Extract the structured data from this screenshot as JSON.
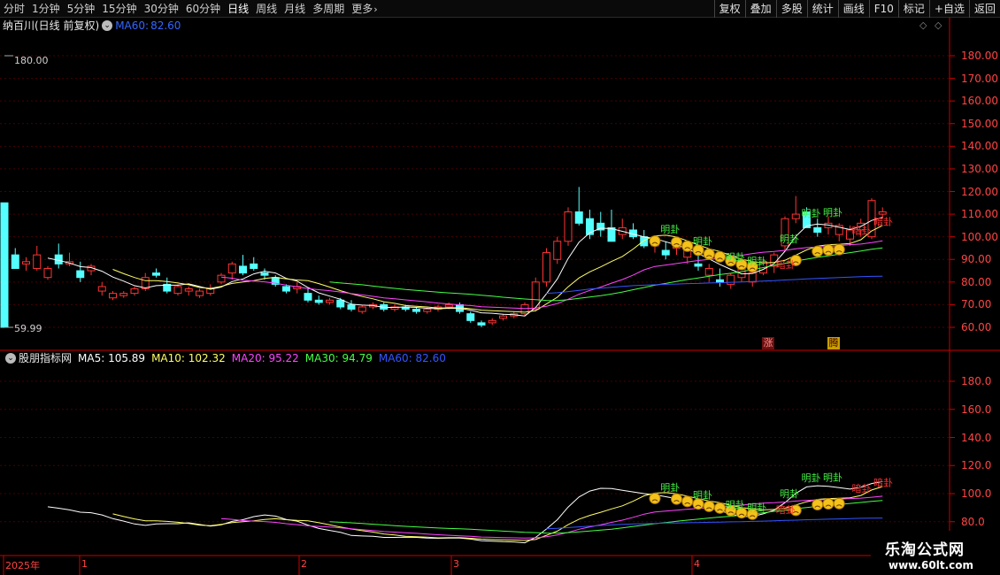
{
  "toolbar": {
    "periods": [
      "分时",
      "1分钟",
      "5分钟",
      "15分钟",
      "30分钟",
      "60分钟",
      "日线",
      "周线",
      "月线",
      "多周期",
      "更多"
    ],
    "active_period": "日线",
    "buttons": [
      "复权",
      "叠加",
      "多股",
      "统计",
      "画线",
      "F10",
      "标记",
      "+自选",
      "返回"
    ]
  },
  "header": {
    "stock_name": "纳百川(日线 前复权)",
    "ma60_label": "MA60:",
    "ma60_value": "82.60"
  },
  "indicator": {
    "name": "股朋指标网",
    "items": [
      {
        "label": "MA5:",
        "value": "105.89",
        "color": "#ffffff"
      },
      {
        "label": "MA10:",
        "value": "102.32",
        "color": "#ffff66"
      },
      {
        "label": "MA20:",
        "value": "95.22",
        "color": "#ff44ff"
      },
      {
        "label": "MA30:",
        "value": "94.79",
        "color": "#44ff44"
      },
      {
        "label": "MA60:",
        "value": "82.60",
        "color": "#3355ff"
      }
    ]
  },
  "price_axis": [
    "180.00",
    "170.00",
    "160.00",
    "150.00",
    "140.00",
    "130.00",
    "120.00",
    "110.00",
    "100.00",
    "90.00",
    "80.00",
    "70.00",
    "60.00"
  ],
  "indicator_axis": [
    "180.0",
    "160.0",
    "140.0",
    "120.0",
    "100.0",
    "80.0"
  ],
  "extremes": {
    "high": "180.00",
    "low": "59.99"
  },
  "date_axis": [
    {
      "label": "2025年"
    },
    {
      "label": "1"
    },
    {
      "label": "2"
    },
    {
      "label": "3"
    },
    {
      "label": "4"
    }
  ],
  "signal_tags": {
    "zhang": "涨",
    "teng": "腾"
  },
  "signal_text": {
    "ming": "明卦",
    "an": "暗卦"
  },
  "watermark": {
    "title": "乐淘公式网",
    "url": "www.60lt.com"
  },
  "colors": {
    "up": "#ff3333",
    "down": "#54ffff",
    "ma5": "#ffffff",
    "ma10": "#ffff66",
    "ma20": "#ff44ff",
    "ma30": "#44ff44",
    "ma60": "#3355ff",
    "axis": "#cc0000"
  },
  "chart_data": {
    "type": "candlestick",
    "ylim": [
      55,
      185
    ],
    "candles": [
      [
        115,
        115,
        60,
        60
      ],
      [
        92,
        95,
        86,
        86
      ],
      [
        88,
        91,
        85,
        89
      ],
      [
        86,
        96,
        85,
        92
      ],
      [
        82,
        87,
        81,
        86
      ],
      [
        92,
        97,
        86,
        88
      ],
      [
        88,
        93,
        87,
        89
      ],
      [
        85,
        89,
        80,
        82
      ],
      [
        85,
        88,
        83,
        87
      ],
      [
        76,
        80,
        74,
        78
      ],
      [
        73,
        76,
        72,
        75
      ],
      [
        74,
        76,
        73,
        75
      ],
      [
        75,
        78,
        74,
        77
      ],
      [
        77,
        84,
        76,
        82
      ],
      [
        84,
        86,
        82,
        83
      ],
      [
        79,
        82,
        75,
        76
      ],
      [
        75,
        79,
        74,
        78
      ],
      [
        76,
        78,
        74,
        77
      ],
      [
        74,
        77,
        73,
        76
      ],
      [
        75,
        79,
        74,
        77
      ],
      [
        80,
        84,
        79,
        83
      ],
      [
        84,
        89,
        81,
        88
      ],
      [
        87,
        92,
        83,
        84
      ],
      [
        88,
        91,
        85,
        86
      ],
      [
        84,
        86,
        81,
        83
      ],
      [
        82,
        83,
        78,
        79
      ],
      [
        78,
        79,
        75,
        76
      ],
      [
        77,
        80,
        75,
        78
      ],
      [
        75,
        77,
        71,
        72
      ],
      [
        72,
        74,
        70,
        71
      ],
      [
        71,
        73,
        70,
        72
      ],
      [
        72,
        73,
        68,
        69
      ],
      [
        70,
        72,
        67,
        68
      ],
      [
        67,
        70,
        66,
        69
      ],
      [
        69,
        71,
        68,
        70
      ],
      [
        70,
        71,
        67,
        68
      ],
      [
        68,
        70,
        67,
        69
      ],
      [
        69,
        70,
        67,
        68
      ],
      [
        68,
        69,
        66,
        67
      ],
      [
        67,
        69,
        66,
        68
      ],
      [
        68,
        70,
        67,
        69
      ],
      [
        69,
        71,
        68,
        70
      ],
      [
        70,
        71,
        66,
        67
      ],
      [
        66,
        67,
        62,
        63
      ],
      [
        62,
        63,
        60,
        61
      ],
      [
        62,
        64,
        61,
        63
      ],
      [
        64,
        66,
        63,
        65
      ],
      [
        65,
        67,
        64,
        66
      ],
      [
        66,
        71,
        65,
        70
      ],
      [
        68,
        82,
        67,
        80
      ],
      [
        80,
        95,
        78,
        93
      ],
      [
        90,
        100,
        88,
        98
      ],
      [
        98,
        113,
        96,
        111
      ],
      [
        111,
        122,
        105,
        106
      ],
      [
        108,
        112,
        99,
        101
      ],
      [
        106,
        111,
        100,
        103
      ],
      [
        104,
        112,
        98,
        98
      ],
      [
        101,
        108,
        99,
        104
      ],
      [
        103,
        106,
        99,
        100
      ],
      [
        100,
        103,
        95,
        96
      ],
      [
        96,
        100,
        93,
        98
      ],
      [
        94,
        98,
        90,
        92
      ],
      [
        95,
        99,
        92,
        96
      ],
      [
        91,
        96,
        88,
        94
      ],
      [
        88,
        92,
        85,
        87
      ],
      [
        83,
        88,
        80,
        86
      ],
      [
        81,
        86,
        78,
        80
      ],
      [
        79,
        84,
        77,
        83
      ],
      [
        82,
        87,
        80,
        86
      ],
      [
        80,
        85,
        78,
        84
      ],
      [
        84,
        90,
        83,
        89
      ],
      [
        87,
        93,
        84,
        92
      ],
      [
        96,
        109,
        94,
        108
      ],
      [
        108,
        118,
        106,
        110
      ],
      [
        111,
        113,
        104,
        104
      ],
      [
        104,
        108,
        100,
        102
      ],
      [
        104,
        109,
        101,
        106
      ],
      [
        101,
        106,
        98,
        105
      ],
      [
        99,
        105,
        96,
        103
      ],
      [
        103,
        108,
        100,
        106
      ],
      [
        100,
        117,
        99,
        116
      ],
      [
        110,
        113,
        108,
        111
      ]
    ],
    "ma5": [
      null,
      null,
      null,
      null,
      90.6,
      89.6,
      88.4,
      86.8,
      86.4,
      84.8,
      82.2,
      80.4,
      78.4,
      77.4,
      78.4,
      78.6,
      78.6,
      79.2,
      78.0,
      76.8,
      77.8,
      80.2,
      81.4,
      83.6,
      84.8,
      84.0,
      81.6,
      80.4,
      77.6,
      75.2,
      73.8,
      72.4,
      70.2,
      69.8,
      69.6,
      68.8,
      68.8,
      69.0,
      68.8,
      68.4,
      68.2,
      68.4,
      68.4,
      67.6,
      66.4,
      66.2,
      65.8,
      65.6,
      65.0,
      68.8,
      74.8,
      81.4,
      90.4,
      97.6,
      101.8,
      103.8,
      103.6,
      102.4,
      101.2,
      100.0,
      99.2,
      97.8,
      96.4,
      94.6,
      92.6,
      90.2,
      87.8,
      85.6,
      83.6,
      83.8,
      85.6,
      88.2,
      93.6,
      100.2,
      104.8,
      105.6,
      105.2,
      104.2,
      103.2,
      104.6,
      107.2,
      108.6
    ],
    "ma10": [
      null,
      null,
      null,
      null,
      null,
      null,
      null,
      null,
      null,
      null,
      85.6,
      83.7,
      82.0,
      80.6,
      80.6,
      80.2,
      79.6,
      78.8,
      77.6,
      77.2,
      78.1,
      79.4,
      80.0,
      80.6,
      81.6,
      82.1,
      81.4,
      80.9,
      80.6,
      79.3,
      77.8,
      76.2,
      74.8,
      73.6,
      72.6,
      71.3,
      70.6,
      69.6,
      69.3,
      69.0,
      68.5,
      68.6,
      68.7,
      68.2,
      67.6,
      67.3,
      67.1,
      66.9,
      66.7,
      67.3,
      70.3,
      73.3,
      77.9,
      81.8,
      84.5,
      86.7,
      89.1,
      91.3,
      94.6,
      98.4,
      100.4,
      100.7,
      99.9,
      98.2,
      96.4,
      94.7,
      93.5,
      91.7,
      90.1,
      89.1,
      88.4,
      88.7,
      89.6,
      91.9,
      94.2,
      95.9,
      96.5,
      96.7,
      97.0,
      98.7,
      102.6,
      105.0
    ],
    "ma20": [
      null,
      null,
      null,
      null,
      null,
      null,
      null,
      null,
      null,
      null,
      null,
      null,
      null,
      null,
      null,
      null,
      null,
      null,
      null,
      null,
      82.2,
      81.7,
      80.8,
      80.4,
      80.1,
      79.5,
      78.6,
      77.9,
      77.1,
      76.6,
      76.2,
      75.6,
      74.9,
      74.3,
      73.7,
      73.0,
      72.6,
      72.1,
      71.7,
      71.2,
      70.7,
      70.3,
      69.9,
      69.6,
      69.1,
      68.9,
      68.7,
      68.5,
      68.3,
      68.5,
      69.3,
      70.5,
      72.4,
      74.6,
      76.3,
      77.8,
      79.5,
      81.1,
      83.1,
      85.4,
      86.9,
      87.5,
      88.2,
      88.9,
      89.5,
      90.0,
      90.5,
      91.2,
      91.8,
      92.6,
      93.2,
      93.5,
      94.0,
      94.7,
      95.2,
      95.5,
      95.8,
      96.1,
      96.5,
      96.8,
      97.4,
      98.2
    ],
    "ma30": [
      null,
      null,
      null,
      null,
      null,
      null,
      null,
      null,
      null,
      null,
      null,
      null,
      null,
      null,
      null,
      null,
      null,
      null,
      null,
      null,
      null,
      null,
      null,
      null,
      null,
      null,
      null,
      null,
      null,
      null,
      80.0,
      79.6,
      79.2,
      78.8,
      78.2,
      77.7,
      77.2,
      76.7,
      76.3,
      75.9,
      75.5,
      75.2,
      74.9,
      74.6,
      74.2,
      73.8,
      73.3,
      72.9,
      72.5,
      72.2,
      71.9,
      71.8,
      72.2,
      72.8,
      73.4,
      74.0,
      74.7,
      75.6,
      76.6,
      77.6,
      78.6,
      79.4,
      80.3,
      81.1,
      81.8,
      82.6,
      83.3,
      83.9,
      84.6,
      85.5,
      86.4,
      87.4,
      88.3,
      89.3,
      90.1,
      90.9,
      91.6,
      92.3,
      93.0,
      93.7,
      94.5,
      95.1
    ],
    "ma60": [
      null,
      null,
      null,
      null,
      null,
      null,
      null,
      null,
      null,
      null,
      null,
      null,
      null,
      null,
      null,
      null,
      null,
      null,
      null,
      null,
      null,
      null,
      null,
      null,
      null,
      null,
      null,
      null,
      null,
      null,
      null,
      null,
      null,
      null,
      null,
      null,
      null,
      null,
      null,
      null,
      null,
      null,
      null,
      null,
      null,
      null,
      null,
      null,
      null,
      null,
      75.0,
      75.3,
      75.8,
      76.3,
      76.9,
      77.3,
      77.7,
      78.1,
      78.4,
      78.6,
      78.8,
      79.0,
      79.1,
      79.3,
      79.4,
      79.6,
      79.7,
      79.9,
      80.0,
      80.2,
      80.4,
      80.6,
      80.9,
      81.1,
      81.4,
      81.6,
      81.8,
      82.0,
      82.2,
      82.4,
      82.5,
      82.6
    ]
  }
}
